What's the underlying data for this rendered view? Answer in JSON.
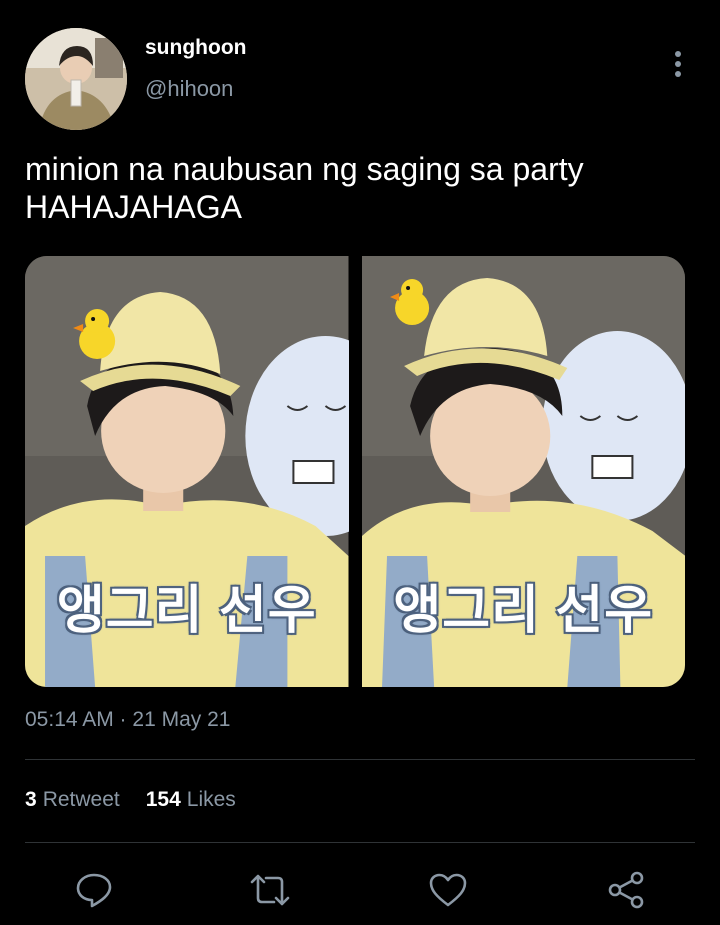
{
  "author": {
    "display_name": "sunghoon",
    "handle": "@hihoon"
  },
  "tweet": {
    "text_line1": "minion na naubusan ng saging sa party",
    "text_line2": "HAHAJAHAGA",
    "timestamp": "05:14 AM · 21 May 21"
  },
  "media": {
    "photos": [
      {
        "caption": "앵그리 선우"
      },
      {
        "caption": "앵그리 선우"
      }
    ]
  },
  "stats": {
    "retweets_count": "3",
    "retweets_label": "Retweet",
    "likes_count": "154",
    "likes_label": "Likes"
  },
  "actions": {
    "icons": [
      "reply-icon",
      "retweet-icon",
      "like-icon",
      "share-icon"
    ]
  },
  "colors": {
    "background": "#000000",
    "text_primary": "#ffffff",
    "text_secondary": "#8b98a5",
    "divider": "#2f3336"
  }
}
